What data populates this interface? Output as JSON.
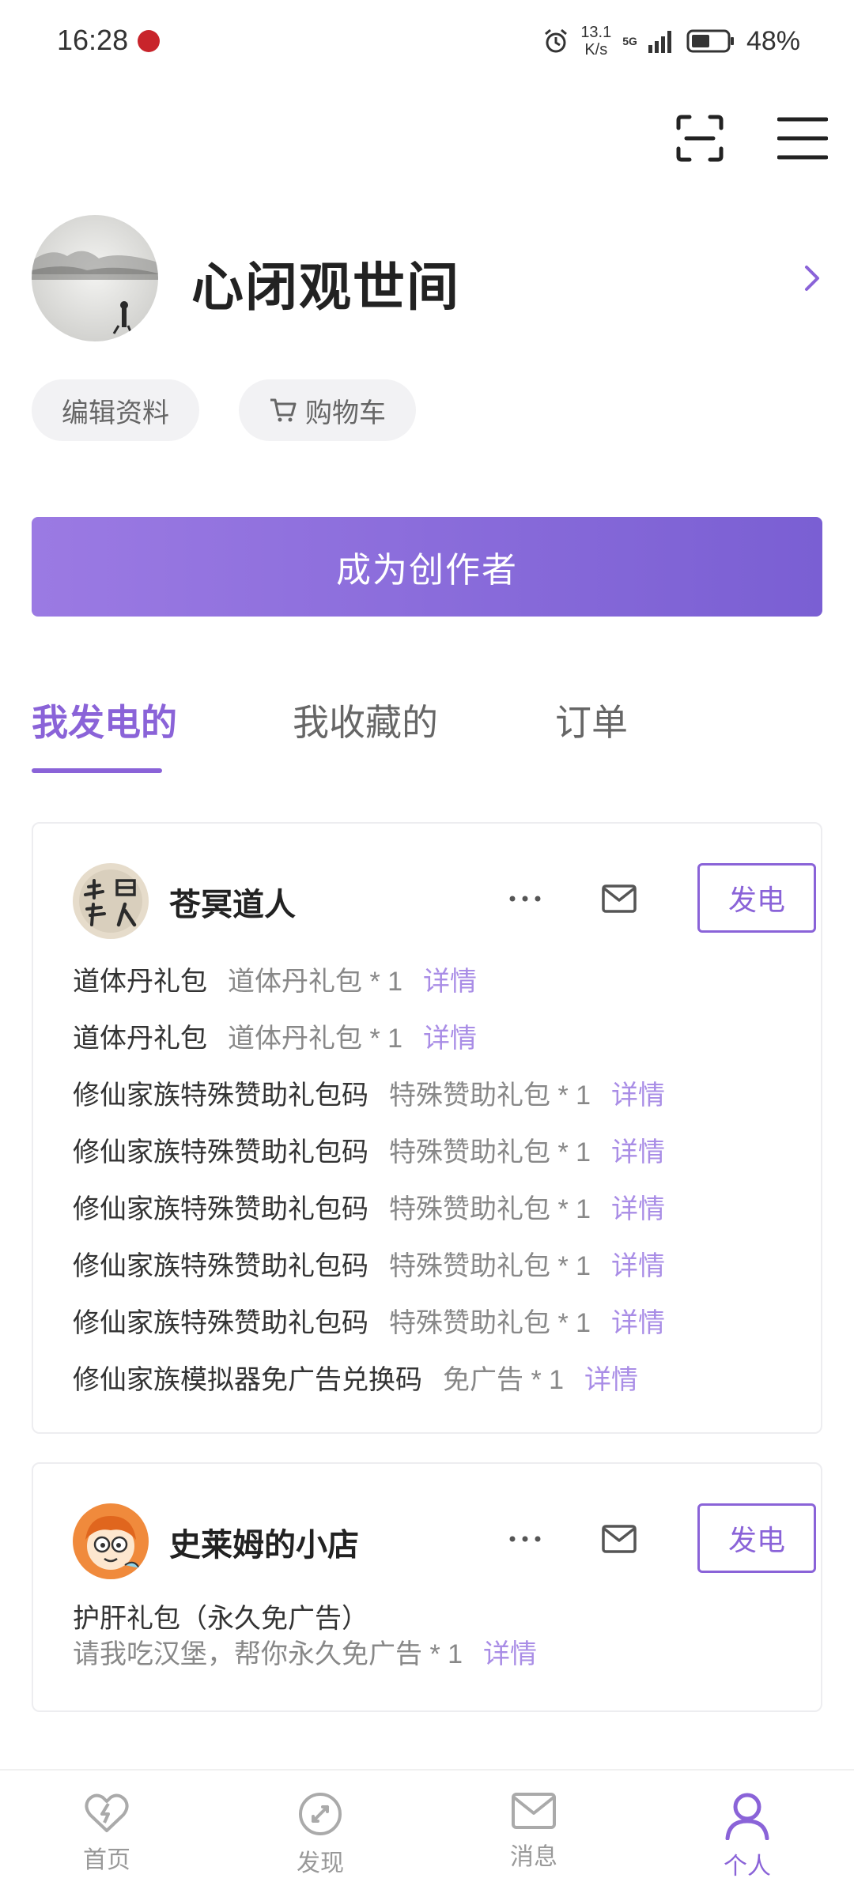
{
  "status_bar": {
    "time": "16:28",
    "speed_value": "13.1",
    "speed_unit": "K/s",
    "network": "5G",
    "battery": "48%"
  },
  "profile": {
    "username": "心闭观世间",
    "edit_label": "编辑资料",
    "cart_label": "购物车"
  },
  "become_creator_label": "成为创作者",
  "tabs": [
    {
      "label": "我发电的"
    },
    {
      "label": "我收藏的"
    },
    {
      "label": "订单"
    }
  ],
  "cards": [
    {
      "creator_name": "苍冥道人",
      "avatar_text": "苍冥道人",
      "power_label": "发电",
      "items": [
        {
          "name": "道体丹礼包",
          "desc": "道体丹礼包 * 1",
          "detail": "详情"
        },
        {
          "name": "道体丹礼包",
          "desc": "道体丹礼包 * 1",
          "detail": "详情"
        },
        {
          "name": "修仙家族特殊赞助礼包码",
          "desc": "特殊赞助礼包 * 1",
          "detail": "详情"
        },
        {
          "name": "修仙家族特殊赞助礼包码",
          "desc": "特殊赞助礼包 * 1",
          "detail": "详情"
        },
        {
          "name": "修仙家族特殊赞助礼包码",
          "desc": "特殊赞助礼包 * 1",
          "detail": "详情"
        },
        {
          "name": "修仙家族特殊赞助礼包码",
          "desc": "特殊赞助礼包 * 1",
          "detail": "详情"
        },
        {
          "name": "修仙家族特殊赞助礼包码",
          "desc": "特殊赞助礼包 * 1",
          "detail": "详情"
        },
        {
          "name": "修仙家族模拟器免广告兑换码",
          "desc": "免广告 * 1",
          "detail": "详情"
        }
      ]
    },
    {
      "creator_name": "史莱姆的小店",
      "power_label": "发电",
      "items": [
        {
          "name": "护肝礼包（永久免广告）",
          "desc": "请我吃汉堡，帮你永久免广告 * 1",
          "detail": "详情"
        }
      ]
    }
  ],
  "bottom_nav": [
    {
      "label": "首页",
      "icon": "heart-bolt-icon"
    },
    {
      "label": "发现",
      "icon": "compass-icon"
    },
    {
      "label": "消息",
      "icon": "mail-icon"
    },
    {
      "label": "个人",
      "icon": "person-icon"
    }
  ],
  "colors": {
    "accent": "#8a63d8",
    "accent_light": "#a98de6",
    "chip_bg": "#f2f2f4"
  }
}
